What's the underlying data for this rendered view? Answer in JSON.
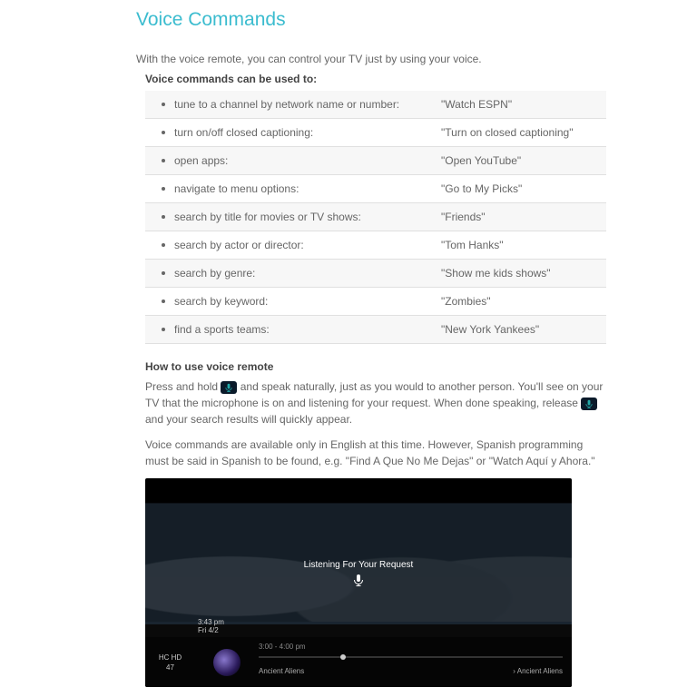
{
  "title": "Voice Commands",
  "intro": "With the voice remote, you can control your TV just by using your voice.",
  "usedto_label": "Voice commands can be used to:",
  "rows": [
    {
      "desc": "tune to a channel by network name or number:",
      "ex": "\"Watch ESPN\""
    },
    {
      "desc": "turn on/off closed captioning:",
      "ex": "\"Turn on closed captioning\""
    },
    {
      "desc": "open apps:",
      "ex": "\"Open YouTube\""
    },
    {
      "desc": "navigate to menu options:",
      "ex": "\"Go to My Picks\""
    },
    {
      "desc": "search by title for movies or TV shows:",
      "ex": "\"Friends\""
    },
    {
      "desc": "search by actor or director:",
      "ex": "\"Tom Hanks\""
    },
    {
      "desc": "search by genre:",
      "ex": "\"Show me kids shows\""
    },
    {
      "desc": "search by keyword:",
      "ex": "\"Zombies\""
    },
    {
      "desc": "find a sports teams:",
      "ex": "\"New York Yankees\""
    }
  ],
  "howto_h": "How to use voice remote",
  "para1a": "Press and hold ",
  "para1b": " and speak naturally, just as you would to another person. You'll see on your TV that the microphone is on and listening for your request. When done speaking, release ",
  "para1c": " and your search results will quickly appear.",
  "para2": "Voice commands are available only in English at this time. However, Spanish programming must be said in Spanish to be found, e.g. \"Find A Que No Me Dejas\" or \"Watch Aquí y Ahora.\"",
  "tv": {
    "listening": "Listening For Your Request",
    "time": "3:43 pm",
    "date": "Fri 4/2",
    "hc": "HC HD",
    "ch": "47",
    "range": "3:00 - 4:00 pm",
    "show": "Ancient Aliens",
    "brand": "ANCIENT ALIENS"
  }
}
